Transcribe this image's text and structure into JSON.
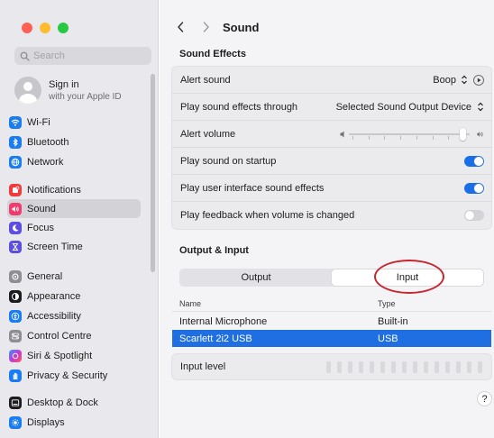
{
  "window": {
    "traffic_lights": {
      "close": "#fe5f57",
      "minimize": "#febc2e",
      "zoom": "#28c840"
    }
  },
  "sidebar": {
    "search_placeholder": "Search",
    "account": {
      "name": "Sign in",
      "subtitle": "with your Apple ID"
    },
    "items": [
      {
        "label": "Wi-Fi",
        "icon": "wifi-icon",
        "color": "#1a7cf2"
      },
      {
        "label": "Bluetooth",
        "icon": "bluetooth-icon",
        "color": "#1a7cf2"
      },
      {
        "label": "Network",
        "icon": "globe-icon",
        "color": "#1a7cf2"
      },
      {
        "label": "Notifications",
        "icon": "bell-icon",
        "color": "#f03c3c"
      },
      {
        "label": "Sound",
        "icon": "speaker-icon",
        "color": "#f03c6c",
        "active": true
      },
      {
        "label": "Focus",
        "icon": "moon-icon",
        "color": "#5b4ee0"
      },
      {
        "label": "Screen Time",
        "icon": "hourglass-icon",
        "color": "#5b4ee0"
      },
      {
        "label": "General",
        "icon": "gear-icon",
        "color": "#8e8e93"
      },
      {
        "label": "Appearance",
        "icon": "appearance-icon",
        "color": "#1c1c1e"
      },
      {
        "label": "Accessibility",
        "icon": "accessibility-icon",
        "color": "#1a7cf2"
      },
      {
        "label": "Control Centre",
        "icon": "control-centre-icon",
        "color": "#8e8e93"
      },
      {
        "label": "Siri & Spotlight",
        "icon": "siri-icon",
        "color": "#3c3c6c"
      },
      {
        "label": "Privacy & Security",
        "icon": "hand-icon",
        "color": "#1a7cf2"
      },
      {
        "label": "Desktop & Dock",
        "icon": "dock-icon",
        "color": "#1c1c1e"
      },
      {
        "label": "Displays",
        "icon": "sun-icon",
        "color": "#1a7cf2"
      }
    ]
  },
  "header": {
    "title": "Sound"
  },
  "sound_effects": {
    "title": "Sound Effects",
    "alert_sound": {
      "label": "Alert sound",
      "value": "Boop"
    },
    "play_through": {
      "label": "Play sound effects through",
      "value": "Selected Sound Output Device"
    },
    "alert_volume": {
      "label": "Alert volume",
      "level": 0.98
    },
    "startup": {
      "label": "Play sound on startup",
      "on": true
    },
    "ui_effects": {
      "label": "Play user interface sound effects",
      "on": true
    },
    "feedback": {
      "label": "Play feedback when volume is changed",
      "on": false
    }
  },
  "output_input": {
    "title": "Output & Input",
    "tabs": [
      {
        "label": "Output",
        "active": false
      },
      {
        "label": "Input",
        "active": true
      }
    ],
    "columns": {
      "name": "Name",
      "type": "Type"
    },
    "devices": [
      {
        "name": "Internal Microphone",
        "type": "Built-in",
        "selected": false
      },
      {
        "name": "Scarlett 2i2 USB",
        "type": "USB",
        "selected": true
      }
    ],
    "input_level": {
      "label": "Input level",
      "level": 0
    }
  },
  "help": "?",
  "accent_color": "#1f6fe3",
  "annotation_color": "#c8262f"
}
